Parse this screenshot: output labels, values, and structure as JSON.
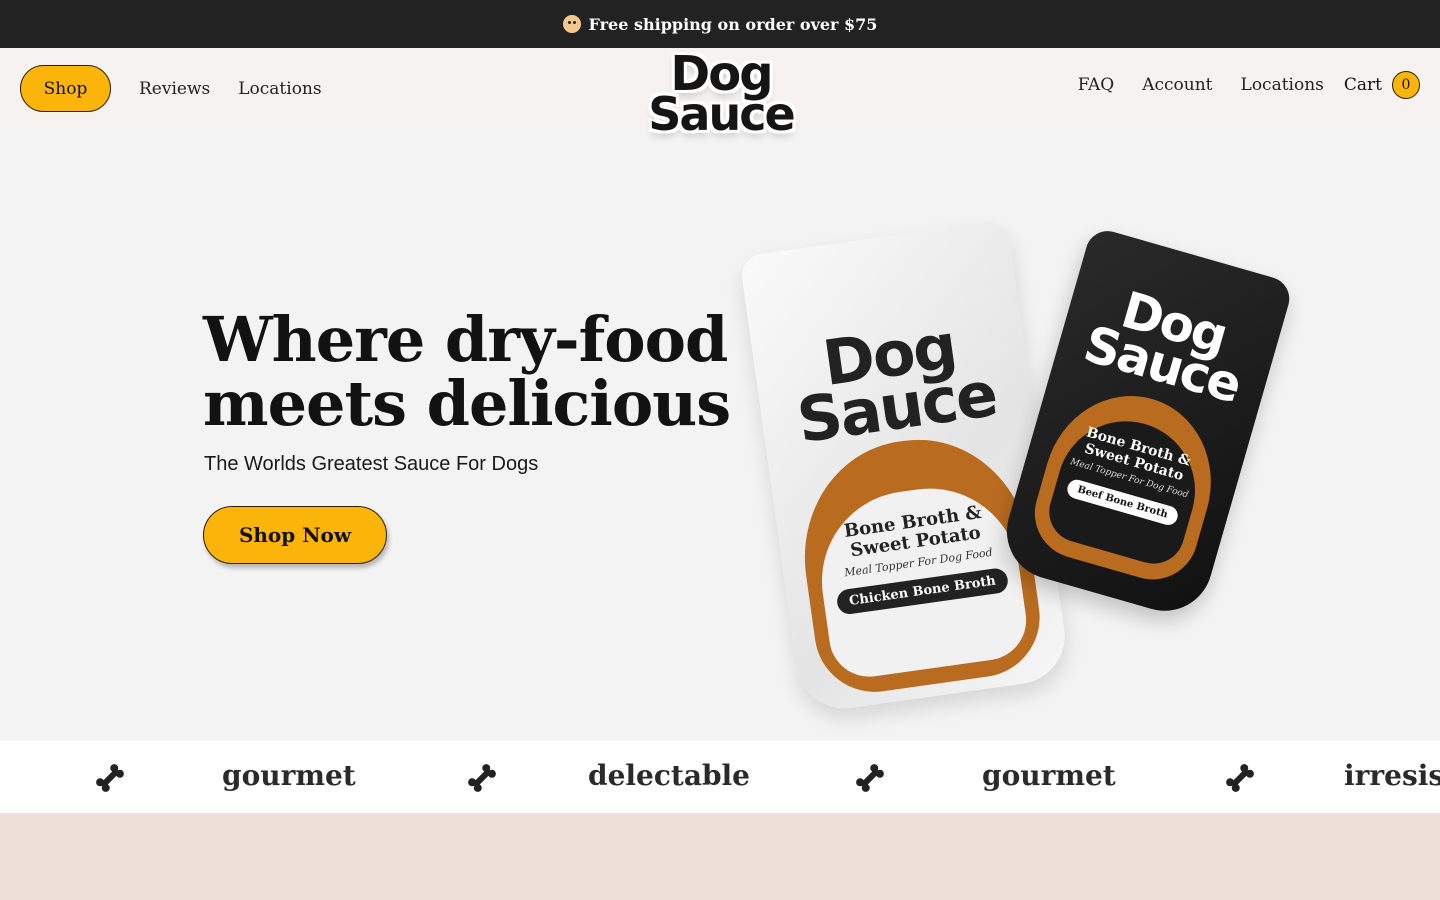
{
  "announcement": {
    "icon": "dog-face-icon",
    "text": "Free shipping on order over $75"
  },
  "header": {
    "left_nav": [
      "Shop",
      "Reviews",
      "Locations"
    ],
    "right_nav": [
      "FAQ",
      "Account",
      "Locations"
    ],
    "cart_label": "Cart",
    "cart_count": "0"
  },
  "logo": {
    "line1": "Dog",
    "line2": "Sauce"
  },
  "hero": {
    "title": "Where dry-food meets delicious",
    "subtitle": "The Worlds Greatest Sauce For Dogs",
    "cta": "Shop Now"
  },
  "products": [
    {
      "brand_line1": "Dog",
      "brand_line2": "Sauce",
      "name_line1": "Bone Broth &",
      "name_line2": "Sweet Potato",
      "tagline": "Meal Topper For Dog Food",
      "flavor": "Chicken Bone Broth"
    },
    {
      "brand_line1": "Dog",
      "brand_line2": "Sauce",
      "name_line1": "Bone Broth &",
      "name_line2": "Sweet Potato",
      "tagline": "Meal Topper For Dog Food",
      "flavor": "Beef Bone Broth"
    }
  ],
  "marquee": {
    "icon": "bone-icon",
    "words": [
      "gourmet",
      "delectable",
      "gourmet",
      "irresist"
    ]
  },
  "colors": {
    "accent": "#fbb40a",
    "announce_bg": "#222222",
    "header_bg": "#f6f2ef",
    "hero_bg": "#f3f3f3",
    "bottom_bg": "#ede0d9",
    "pouch_arch": "#b96c1f"
  }
}
